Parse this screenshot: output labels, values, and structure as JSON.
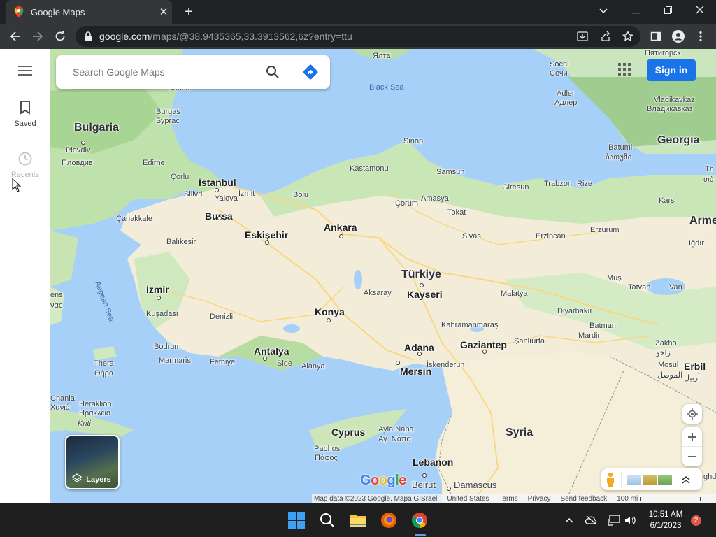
{
  "browser": {
    "tab_title": "Google Maps",
    "tab_close": "✕",
    "new_tab": "+",
    "url_host": "google.com",
    "url_path": "/maps/@38.9435365,33.3913562,6z?entry=ttu"
  },
  "sidebar": {
    "saved_label": "Saved",
    "recents_label": "Recents"
  },
  "search": {
    "placeholder": "Search Google Maps"
  },
  "header": {
    "sign_in_label": "Sign in"
  },
  "layers": {
    "label": "Layers"
  },
  "footer": {
    "map_data": "Map data ©2023 Google, Mapa GISrael",
    "region": "United States",
    "terms": "Terms",
    "privacy": "Privacy",
    "feedback": "Send feedback",
    "scale": "100 mi"
  },
  "map": {
    "logo": "Google",
    "labels": {
      "bulgaria": "Bulgaria",
      "georgia": "Georgia",
      "turkiye": "Türkiye",
      "syria": "Syria",
      "cyprus": "Cyprus",
      "lebanon": "Lebanon",
      "black_sea": "Black Sea",
      "aegean_sea": "Aegean Sea",
      "armenia": "Arme",
      "ankara": "Ankara",
      "bursa": "Bursa",
      "eskisehir": "Eskişehir",
      "izmir": "İzmir",
      "konya": "Konya",
      "antalya": "Antalya",
      "kayseri": "Kayseri",
      "adana": "Adana",
      "mersin": "Mersin",
      "gaziantep": "Gaziantep",
      "istanbul": "İstanbul",
      "plovdiv": "Plovdiv",
      "plovdiv_cyr": "Пловдив",
      "erbil": "Erbil",
      "erbil_ar": "أربيل",
      "varna": "Варна",
      "yalta": "Ялта",
      "burgas": "Burgas",
      "burgas_cyr": "Бургас",
      "sochi": "Sochi",
      "sochi_cyr": "Сочи",
      "adler": "Adler",
      "adler_cyr": "Адлер",
      "pyatigorsk": "Пятигорск",
      "vladikavkaz": "Vladikavkaz",
      "vladikavkaz_cyr": "Владикавказ",
      "batumi": "Batumi",
      "batumi_geo": "ბათუმი",
      "tb": "Tb",
      "tb_geo": "თბ",
      "edirne": "Edirne",
      "corlu": "Çorlu",
      "silivri": "Silivri",
      "izmit": "İzmit",
      "yalova": "Yalova",
      "bolu": "Bolu",
      "kastamonu": "Kastamonu",
      "sinop": "Sinop",
      "samsun": "Samsun",
      "giresun": "Giresun",
      "trabzon": "Trabzon",
      "rize": "Rize",
      "kars": "Kars",
      "corum": "Çorum",
      "amasya": "Amasya",
      "tokat": "Tokat",
      "sivas": "Sivas",
      "erzincan": "Erzincan",
      "erzurum": "Erzurum",
      "igdir": "Iğdır",
      "canakkale": "Çanakkale",
      "balikesir": "Balıkesir",
      "aksaray": "Aksaray",
      "malatya": "Malatya",
      "mus": "Muş",
      "tatvan": "Tatvan",
      "van": "Van",
      "athens": "ens",
      "athens2": "νας",
      "kusadasi": "Kuşadası",
      "denizli": "Denizli",
      "diyarbakir": "Diyarbakır",
      "batman": "Batman",
      "mardin": "Mardin",
      "kahramanmaras": "Kahramanmaraş",
      "sanliurfa": "Şanlıurfa",
      "zakho": "Zakho",
      "zakho_ar": "زاخو",
      "mosul": "Mosul",
      "mosul_ar": "الموصل",
      "bodrum": "Bodrum",
      "marmaris": "Marmaris",
      "fethiye": "Fethiye",
      "side": "Side",
      "alanya": "Alanya",
      "iskenderun": "İskenderun",
      "thera": "Thera",
      "thera_gr": "Θήρα",
      "chania": "Chania",
      "chania_gr": "Χανιά",
      "heraklion": "Heraklion",
      "heraklion_gr": "Ηράκλειο",
      "kriti": "Κriti",
      "ayia_napa": "Ayia Napa",
      "ayia_napa_gr": "Αγ. Νάπα",
      "paphos": "Paphos",
      "paphos_gr": "Πάφος",
      "beirut": "Beirut",
      "damascus": "Damascus",
      "ghd": "ghd"
    }
  },
  "taskbar": {
    "time": "10:51 AM",
    "date": "6/1/2023",
    "notifications": "2"
  }
}
